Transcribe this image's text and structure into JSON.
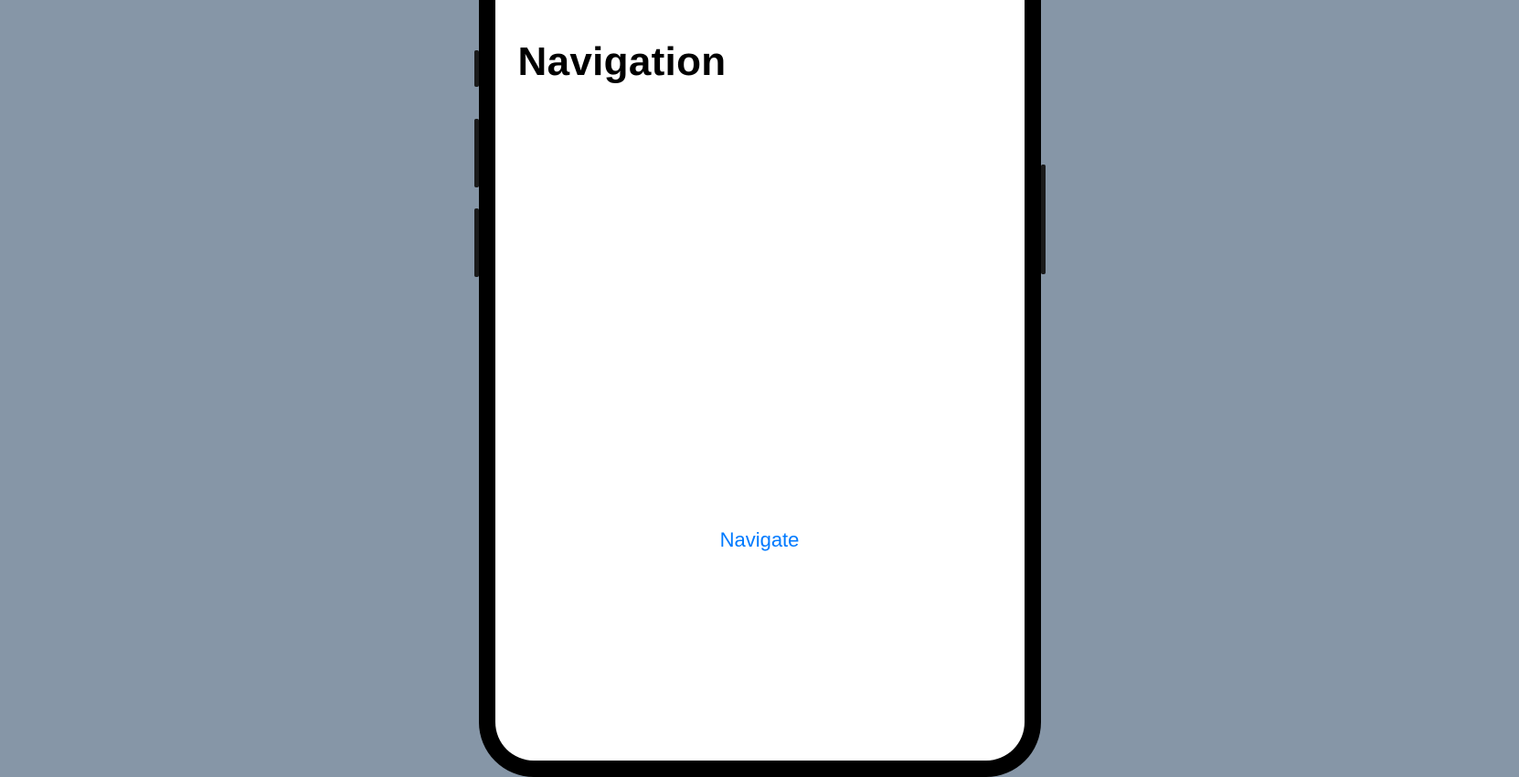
{
  "header": {
    "title": "Navigation"
  },
  "actions": {
    "navigate_label": "Navigate"
  },
  "colors": {
    "background": "#8696a7",
    "link": "#007aff"
  }
}
